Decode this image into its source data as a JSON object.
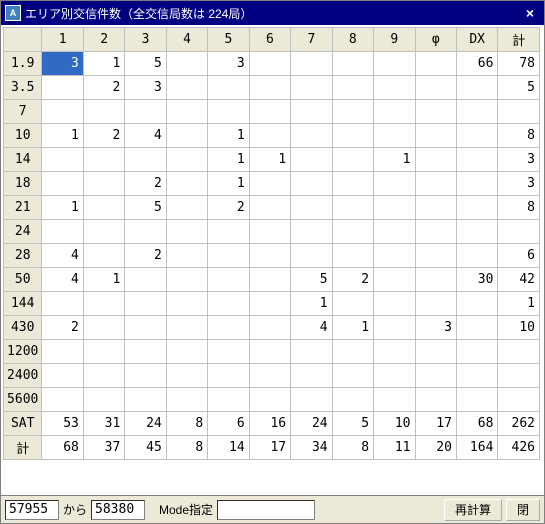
{
  "window": {
    "title": "エリア別交信件数（全交信局数は 224局）",
    "close_glyph": "×"
  },
  "grid": {
    "columns": [
      "1",
      "2",
      "3",
      "4",
      "5",
      "6",
      "7",
      "8",
      "9",
      "φ",
      "DX",
      "計"
    ],
    "rows": [
      {
        "head": "1.9",
        "cells": [
          "3",
          "1",
          "5",
          "",
          "3",
          "",
          "",
          "",
          "",
          "",
          "66",
          "78"
        ]
      },
      {
        "head": "3.5",
        "cells": [
          "",
          "2",
          "3",
          "",
          "",
          "",
          "",
          "",
          "",
          "",
          "",
          "5"
        ]
      },
      {
        "head": "7",
        "cells": [
          "",
          "",
          "",
          "",
          "",
          "",
          "",
          "",
          "",
          "",
          "",
          ""
        ]
      },
      {
        "head": "10",
        "cells": [
          "1",
          "2",
          "4",
          "",
          "1",
          "",
          "",
          "",
          "",
          "",
          "",
          "8"
        ]
      },
      {
        "head": "14",
        "cells": [
          "",
          "",
          "",
          "",
          "1",
          "1",
          "",
          "",
          "1",
          "",
          "",
          "3"
        ]
      },
      {
        "head": "18",
        "cells": [
          "",
          "",
          "2",
          "",
          "1",
          "",
          "",
          "",
          "",
          "",
          "",
          "3"
        ]
      },
      {
        "head": "21",
        "cells": [
          "1",
          "",
          "5",
          "",
          "2",
          "",
          "",
          "",
          "",
          "",
          "",
          "8"
        ]
      },
      {
        "head": "24",
        "cells": [
          "",
          "",
          "",
          "",
          "",
          "",
          "",
          "",
          "",
          "",
          "",
          ""
        ]
      },
      {
        "head": "28",
        "cells": [
          "4",
          "",
          "2",
          "",
          "",
          "",
          "",
          "",
          "",
          "",
          "",
          "6"
        ]
      },
      {
        "head": "50",
        "cells": [
          "4",
          "1",
          "",
          "",
          "",
          "",
          "5",
          "2",
          "",
          "",
          "30",
          "42"
        ]
      },
      {
        "head": "144",
        "cells": [
          "",
          "",
          "",
          "",
          "",
          "",
          "1",
          "",
          "",
          "",
          "",
          "1"
        ]
      },
      {
        "head": "430",
        "cells": [
          "2",
          "",
          "",
          "",
          "",
          "",
          "4",
          "1",
          "",
          "3",
          "",
          "10"
        ]
      },
      {
        "head": "1200",
        "cells": [
          "",
          "",
          "",
          "",
          "",
          "",
          "",
          "",
          "",
          "",
          "",
          ""
        ]
      },
      {
        "head": "2400",
        "cells": [
          "",
          "",
          "",
          "",
          "",
          "",
          "",
          "",
          "",
          "",
          "",
          ""
        ]
      },
      {
        "head": "5600",
        "cells": [
          "",
          "",
          "",
          "",
          "",
          "",
          "",
          "",
          "",
          "",
          "",
          ""
        ]
      },
      {
        "head": "SAT",
        "cells": [
          "53",
          "31",
          "24",
          "8",
          "6",
          "16",
          "24",
          "5",
          "10",
          "17",
          "68",
          "262"
        ]
      },
      {
        "head": "計",
        "cells": [
          "68",
          "37",
          "45",
          "8",
          "14",
          "17",
          "34",
          "8",
          "11",
          "20",
          "164",
          "426"
        ]
      }
    ],
    "selected": {
      "row": 0,
      "col": 0
    }
  },
  "bottom": {
    "from_value": "57955",
    "kara_label": "から",
    "to_value": "58380",
    "mode_label": "Mode指定",
    "mode_value": "",
    "recalc_label": "再計算",
    "close_label": "閉"
  }
}
